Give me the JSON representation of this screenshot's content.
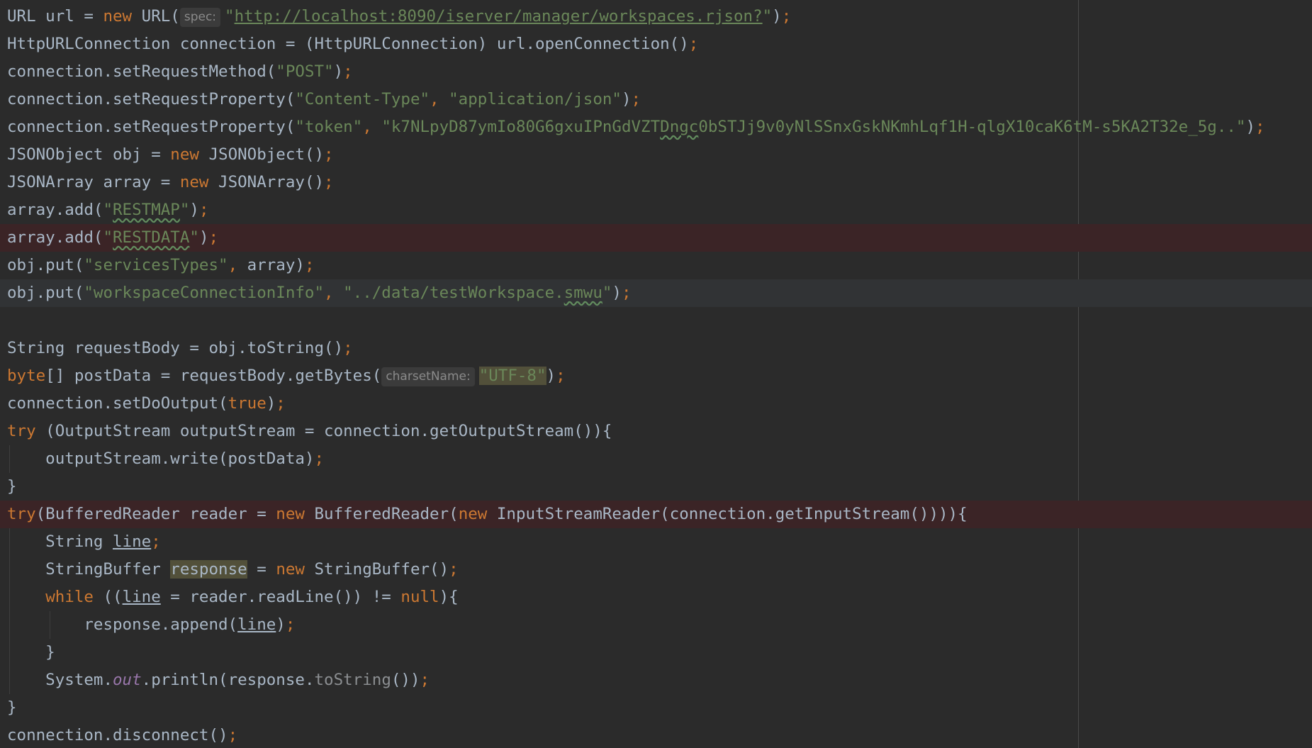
{
  "editor": {
    "lines": [
      {
        "id": "url-decl",
        "tokens": [
          {
            "text": "URL url = ",
            "c": "t-plain"
          },
          {
            "text": "new",
            "c": "t-kw"
          },
          {
            "text": " URL(",
            "c": "t-plain"
          },
          {
            "text": "spec:",
            "c": "hint"
          },
          {
            "text": "\"",
            "c": "t-str"
          },
          {
            "text": "http://localhost:8090/iserver/manager/workspaces.rjson?",
            "c": "t-url"
          },
          {
            "text": "\"",
            "c": "t-str"
          },
          {
            "text": ")",
            "c": "t-plain"
          },
          {
            "text": ";",
            "c": "t-punct"
          }
        ]
      },
      {
        "id": "connection-decl",
        "tokens": [
          {
            "text": "HttpURLConnection connection = (HttpURLConnection) url.openConnection()",
            "c": "t-plain"
          },
          {
            "text": ";",
            "c": "t-punct"
          }
        ]
      },
      {
        "id": "set-method",
        "tokens": [
          {
            "text": "connection.setRequestMethod(",
            "c": "t-plain"
          },
          {
            "text": "\"POST\"",
            "c": "t-str"
          },
          {
            "text": ")",
            "c": "t-plain"
          },
          {
            "text": ";",
            "c": "t-punct"
          }
        ]
      },
      {
        "id": "set-content-type",
        "tokens": [
          {
            "text": "connection.setRequestProperty(",
            "c": "t-plain"
          },
          {
            "text": "\"Content-Type\"",
            "c": "t-str"
          },
          {
            "text": ", ",
            "c": "t-punct"
          },
          {
            "text": "\"application/json\"",
            "c": "t-str"
          },
          {
            "text": ")",
            "c": "t-plain"
          },
          {
            "text": ";",
            "c": "t-punct"
          }
        ]
      },
      {
        "id": "set-token",
        "tokens": [
          {
            "text": "connection.setRequestProperty(",
            "c": "t-plain"
          },
          {
            "text": "\"token\"",
            "c": "t-str"
          },
          {
            "text": ", ",
            "c": "t-punct"
          },
          {
            "text": "\"k7NLpyD87ymIo80G6gxuIPnGdVZT",
            "c": "t-str"
          },
          {
            "text": "Dngc",
            "c": "t-str t-typo"
          },
          {
            "text": "0bSTJj9v0yNlSSnxGskNKmhLqf1H-qlgX10caK6tM-s5KA2T32e_5g..\"",
            "c": "t-str"
          },
          {
            "text": ")",
            "c": "t-plain"
          },
          {
            "text": ";",
            "c": "t-punct"
          }
        ]
      },
      {
        "id": "obj-decl",
        "tokens": [
          {
            "text": "JSONObject obj = ",
            "c": "t-plain"
          },
          {
            "text": "new",
            "c": "t-kw"
          },
          {
            "text": " JSONObject()",
            "c": "t-plain"
          },
          {
            "text": ";",
            "c": "t-punct"
          }
        ]
      },
      {
        "id": "array-decl",
        "tokens": [
          {
            "text": "JSONArray array = ",
            "c": "t-plain"
          },
          {
            "text": "new",
            "c": "t-kw"
          },
          {
            "text": " JSONArray()",
            "c": "t-plain"
          },
          {
            "text": ";",
            "c": "t-punct"
          }
        ]
      },
      {
        "id": "array-add-restmap",
        "tokens": [
          {
            "text": "array.add(",
            "c": "t-plain"
          },
          {
            "text": "\"",
            "c": "t-str"
          },
          {
            "text": "RESTMAP",
            "c": "t-str t-typo"
          },
          {
            "text": "\"",
            "c": "t-str"
          },
          {
            "text": ")",
            "c": "t-plain"
          },
          {
            "text": ";",
            "c": "t-punct"
          }
        ]
      },
      {
        "id": "array-add-restdata",
        "bg": "error-bg",
        "tokens": [
          {
            "text": "array.add(",
            "c": "t-plain"
          },
          {
            "text": "\"",
            "c": "t-str"
          },
          {
            "text": "RESTDATA",
            "c": "t-str t-typo"
          },
          {
            "text": "\"",
            "c": "t-str"
          },
          {
            "text": ")",
            "c": "t-plain"
          },
          {
            "text": ";",
            "c": "t-punct"
          }
        ]
      },
      {
        "id": "put-services-types",
        "tokens": [
          {
            "text": "obj.put(",
            "c": "t-plain"
          },
          {
            "text": "\"servicesTypes\"",
            "c": "t-str"
          },
          {
            "text": ", ",
            "c": "t-punct"
          },
          {
            "text": "array)",
            "c": "t-plain"
          },
          {
            "text": ";",
            "c": "t-punct"
          }
        ]
      },
      {
        "id": "put-workspace-info",
        "bg": "caret-bg",
        "tokens": [
          {
            "text": "obj.put(",
            "c": "t-plain"
          },
          {
            "text": "\"workspaceConnectionInfo\"",
            "c": "t-str"
          },
          {
            "text": ", ",
            "c": "t-punct"
          },
          {
            "text": "\"../data/testWorkspace.",
            "c": "t-str"
          },
          {
            "text": "smwu",
            "c": "t-str t-typo"
          },
          {
            "text": "\"",
            "c": "t-str"
          },
          {
            "text": ")",
            "c": "t-plain"
          },
          {
            "text": ";",
            "c": "t-punct"
          }
        ]
      },
      {
        "id": "blank",
        "tokens": []
      },
      {
        "id": "request-body-decl",
        "tokens": [
          {
            "text": "String requestBody = obj.toString()",
            "c": "t-plain"
          },
          {
            "text": ";",
            "c": "t-punct"
          }
        ]
      },
      {
        "id": "post-data-decl",
        "tokens": [
          {
            "text": "byte",
            "c": "t-kw"
          },
          {
            "text": "[] postData = requestBody.getBytes(",
            "c": "t-plain"
          },
          {
            "text": "charsetName:",
            "c": "hint"
          },
          {
            "text": "\"UTF-8\"",
            "c": "t-str t-hl"
          },
          {
            "text": ")",
            "c": "t-plain"
          },
          {
            "text": ";",
            "c": "t-punct"
          }
        ]
      },
      {
        "id": "set-do-output",
        "tokens": [
          {
            "text": "connection.setDoOutput(",
            "c": "t-plain"
          },
          {
            "text": "true",
            "c": "t-kw"
          },
          {
            "text": ")",
            "c": "t-plain"
          },
          {
            "text": ";",
            "c": "t-punct"
          }
        ]
      },
      {
        "id": "try-output-stream",
        "tokens": [
          {
            "text": "try",
            "c": "t-kw"
          },
          {
            "text": " (OutputStream outputStream = connection.getOutputStream()){",
            "c": "t-plain"
          }
        ]
      },
      {
        "id": "output-stream-write",
        "guides": 1,
        "tokens": [
          {
            "text": "    outputStream.write(postData)",
            "c": "t-plain"
          },
          {
            "text": ";",
            "c": "t-punct"
          }
        ]
      },
      {
        "id": "close-brace-1",
        "tokens": [
          {
            "text": "}",
            "c": "t-plain"
          }
        ]
      },
      {
        "id": "try-buffered-reader",
        "bg": "error-bg",
        "tokens": [
          {
            "text": "try",
            "c": "t-kw"
          },
          {
            "text": "(BufferedReader reader = ",
            "c": "t-plain"
          },
          {
            "text": "new",
            "c": "t-kw"
          },
          {
            "text": " BufferedReader(",
            "c": "t-plain"
          },
          {
            "text": "new",
            "c": "t-kw"
          },
          {
            "text": " InputStreamReader(connection.getInputStream()))){",
            "c": "t-plain"
          }
        ]
      },
      {
        "id": "line-decl",
        "guides": 1,
        "tokens": [
          {
            "text": "    String ",
            "c": "t-plain"
          },
          {
            "text": "line",
            "c": "t-var"
          },
          {
            "text": ";",
            "c": "t-punct"
          }
        ]
      },
      {
        "id": "response-decl",
        "guides": 1,
        "tokens": [
          {
            "text": "    StringBuffer ",
            "c": "t-plain"
          },
          {
            "text": "response",
            "c": "t-plain t-hl"
          },
          {
            "text": " = ",
            "c": "t-plain"
          },
          {
            "text": "new",
            "c": "t-kw"
          },
          {
            "text": " StringBuffer()",
            "c": "t-plain"
          },
          {
            "text": ";",
            "c": "t-punct"
          }
        ]
      },
      {
        "id": "while-read-line",
        "guides": 1,
        "tokens": [
          {
            "text": "    ",
            "c": "t-plain"
          },
          {
            "text": "while",
            "c": "t-kw"
          },
          {
            "text": " ((",
            "c": "t-plain"
          },
          {
            "text": "line",
            "c": "t-var"
          },
          {
            "text": " = reader.readLine()) != ",
            "c": "t-plain"
          },
          {
            "text": "null",
            "c": "t-kw"
          },
          {
            "text": "){",
            "c": "t-plain"
          }
        ]
      },
      {
        "id": "response-append",
        "guides": 2,
        "tokens": [
          {
            "text": "        response.append(",
            "c": "t-plain"
          },
          {
            "text": "line",
            "c": "t-var"
          },
          {
            "text": ")",
            "c": "t-plain"
          },
          {
            "text": ";",
            "c": "t-punct"
          }
        ]
      },
      {
        "id": "close-brace-while",
        "guides": 1,
        "tokens": [
          {
            "text": "    }",
            "c": "t-plain"
          }
        ]
      },
      {
        "id": "system-out-println",
        "guides": 1,
        "tokens": [
          {
            "text": "    System.",
            "c": "t-plain"
          },
          {
            "text": "out",
            "c": "t-static"
          },
          {
            "text": ".println(response.",
            "c": "t-plain"
          },
          {
            "text": "toString",
            "c": "t-dim"
          },
          {
            "text": "())",
            "c": "t-plain"
          },
          {
            "text": ";",
            "c": "t-punct"
          }
        ]
      },
      {
        "id": "close-brace-2",
        "tokens": [
          {
            "text": "}",
            "c": "t-plain"
          }
        ]
      },
      {
        "id": "connection-disconnect",
        "tokens": [
          {
            "text": "connection.disconnect()",
            "c": "t-plain"
          },
          {
            "text": ";",
            "c": "t-punct"
          }
        ]
      }
    ]
  }
}
